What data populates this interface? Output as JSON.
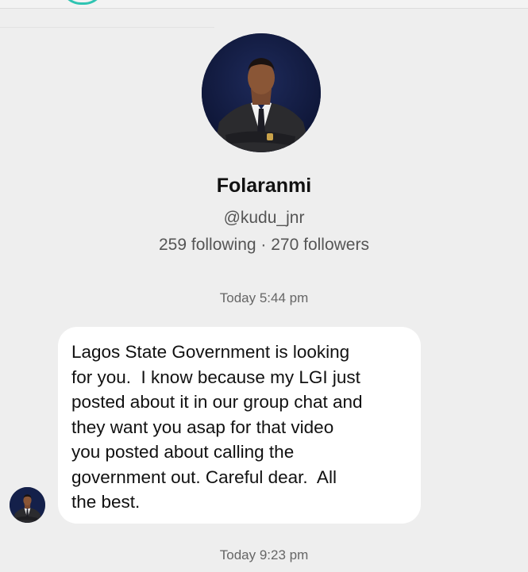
{
  "profile": {
    "display_name": "Folaranmi",
    "username": "@kudu_jnr",
    "follow_stats": "259 following · 270 followers"
  },
  "messages": [
    {
      "timestamp": "Today 5:44 pm",
      "text": "Lagos State Government is looking\nfor you.  I know because my LGI just\nposted about it in our group chat and\nthey want you asap for that video\nyou posted about calling the\ngovernment out. Careful dear.  All\nthe best."
    }
  ],
  "next_timestamp": "Today 9:23 pm",
  "colors": {
    "background": "#eeeeee",
    "bubble": "#ffffff",
    "accent": "#2fc4b2"
  },
  "icons": {
    "avatar": "profile-photo-icon"
  }
}
